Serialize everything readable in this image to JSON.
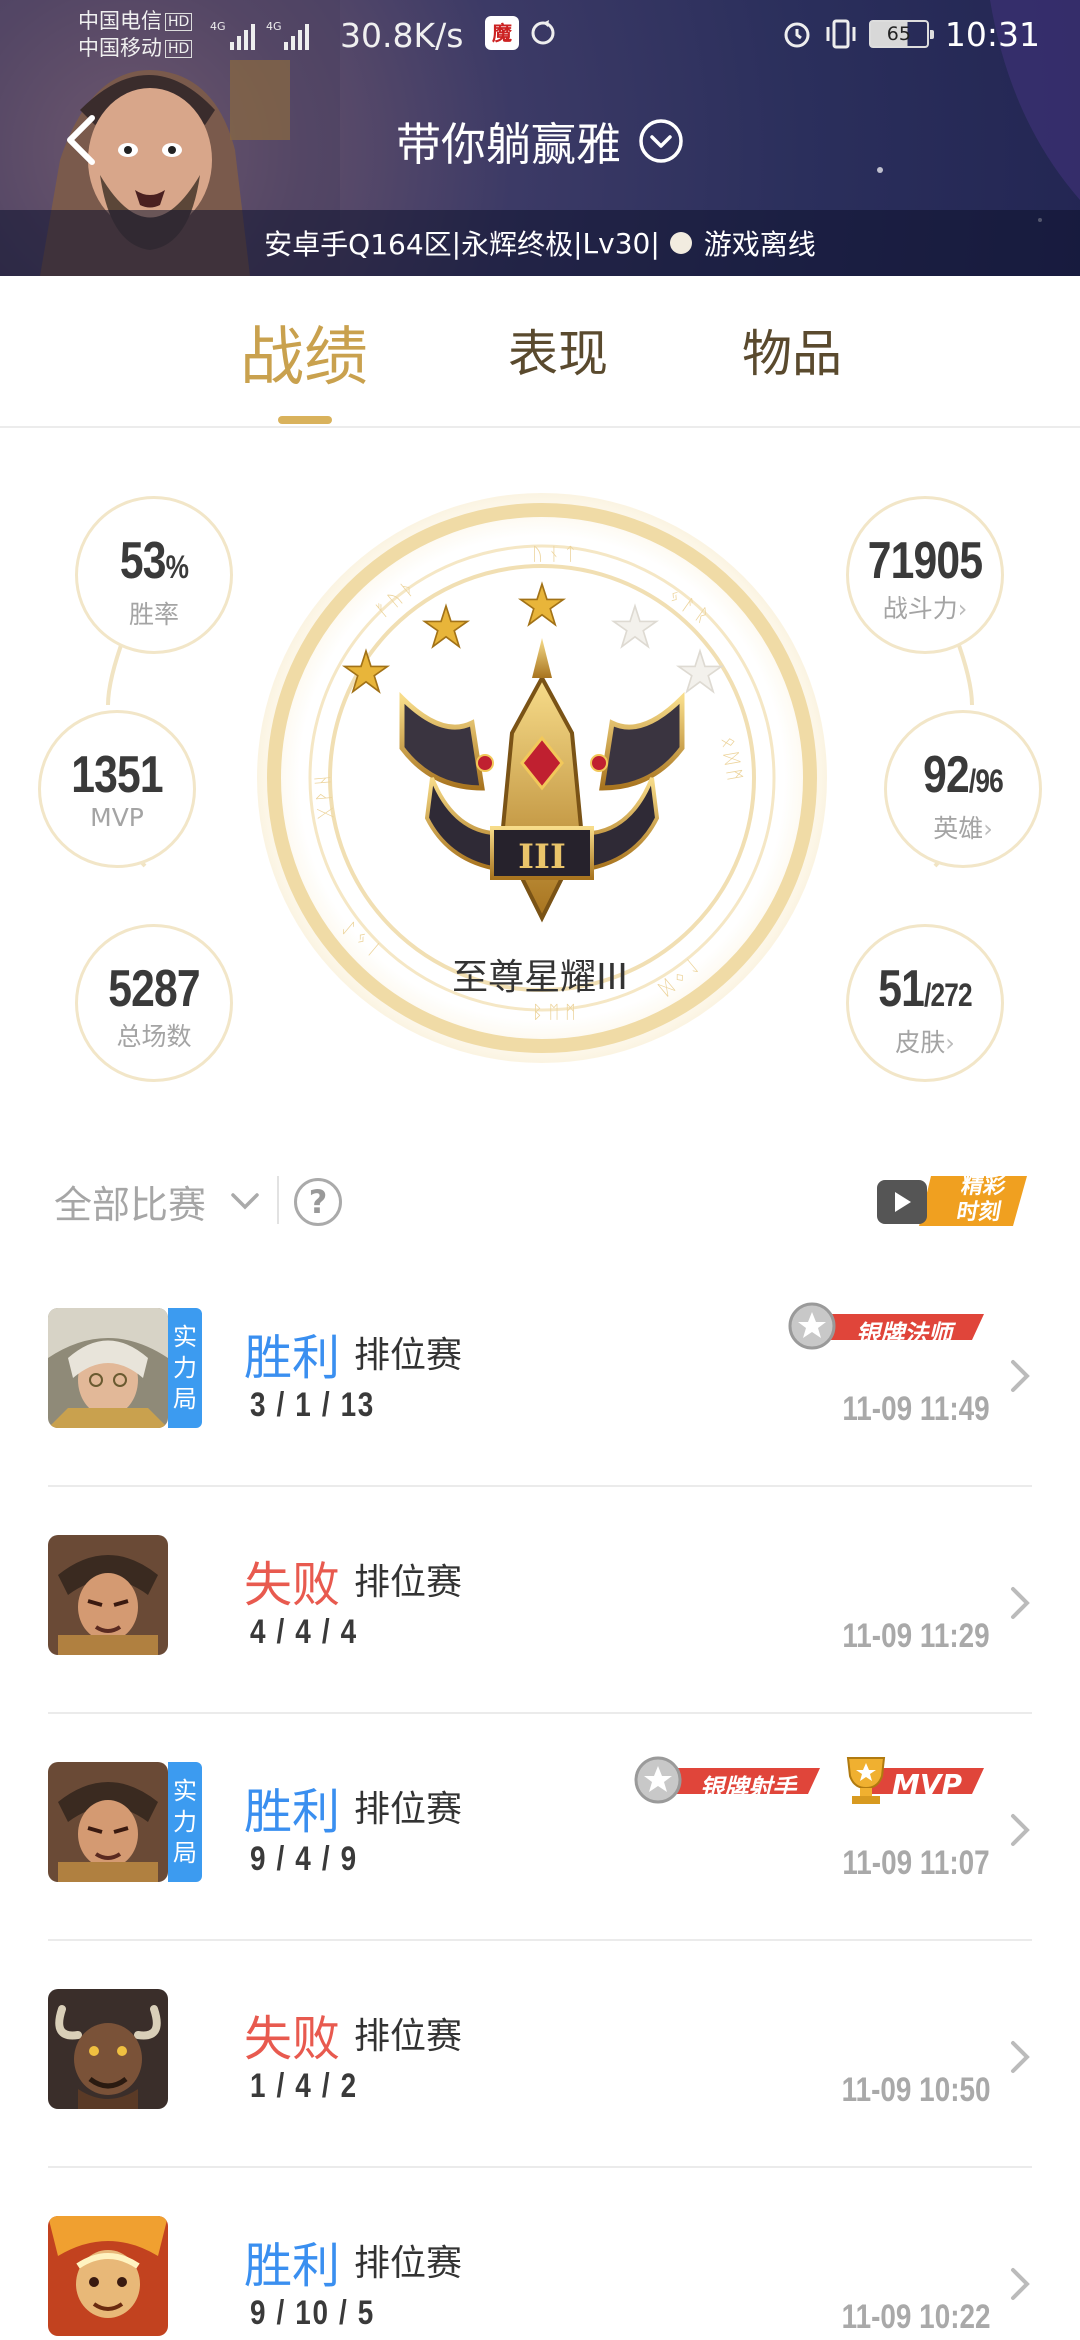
{
  "status_bar": {
    "carrier_1": "中国电信",
    "carrier_2": "中国移动",
    "hd": "HD",
    "net": "4G",
    "speed": "30.8K/s",
    "app_icon": "魔",
    "battery": "65",
    "time": "10:31",
    "icons": [
      "signal-icon",
      "alarm-icon",
      "vibrate-icon",
      "battery-icon",
      "sync-icon"
    ]
  },
  "header": {
    "nickname": "带你躺赢雅",
    "server": "安卓手Q164区",
    "rank_title": "永辉终极",
    "level": "Lv30",
    "online_status": "游戏离线",
    "separator": " | "
  },
  "tabs": [
    {
      "label": "战绩",
      "active": true
    },
    {
      "label": "表现",
      "active": false
    },
    {
      "label": "物品",
      "active": false
    }
  ],
  "stats": {
    "win_rate": {
      "value": "53",
      "unit": "%",
      "label": "胜率"
    },
    "mvp": {
      "value": "1351",
      "label": "MVP"
    },
    "total_games": {
      "value": "5287",
      "label": "总场数"
    },
    "combat_power": {
      "value": "71905",
      "label": "战斗力"
    },
    "heroes": {
      "value": "92",
      "total": "/96",
      "label": "英雄"
    },
    "skins": {
      "value": "51",
      "total": "/272",
      "label": "皮肤"
    },
    "rank": {
      "name": "至尊星耀III",
      "stars": 3,
      "max_stars": 5,
      "tier_numeral": "III"
    }
  },
  "filter": {
    "label": "全部比赛",
    "help": "?",
    "highlights_label_1": "精彩",
    "highlights_label_2": "时刻"
  },
  "matches": [
    {
      "result": "胜利",
      "outcome": "win",
      "mode": "排位赛",
      "kda": "3 / 1 / 13",
      "time": "11-09 11:49",
      "ranked_tag": [
        "实",
        "力",
        "局"
      ],
      "badges": [
        "银牌法师"
      ]
    },
    {
      "result": "失败",
      "outcome": "lose",
      "mode": "排位赛",
      "kda": "4 / 4 / 4",
      "time": "11-09 11:29",
      "ranked_tag": [],
      "badges": []
    },
    {
      "result": "胜利",
      "outcome": "win",
      "mode": "排位赛",
      "kda": "9 / 4 / 9",
      "time": "11-09 11:07",
      "ranked_tag": [
        "实",
        "力",
        "局"
      ],
      "badges": [
        "银牌射手",
        "MVP"
      ]
    },
    {
      "result": "失败",
      "outcome": "lose",
      "mode": "排位赛",
      "kda": "1 / 4 / 2",
      "time": "11-09 10:50",
      "ranked_tag": [],
      "badges": []
    },
    {
      "result": "胜利",
      "outcome": "win",
      "mode": "排位赛",
      "kda": "9 / 10 / 5",
      "time": "11-09 10:22",
      "ranked_tag": [],
      "badges": []
    }
  ],
  "colors": {
    "accent_gold": "#c9a14e",
    "win_blue": "#3a8ff0",
    "lose_red": "#e85a4f",
    "ranked_tag_blue": "#3c9bf0"
  }
}
